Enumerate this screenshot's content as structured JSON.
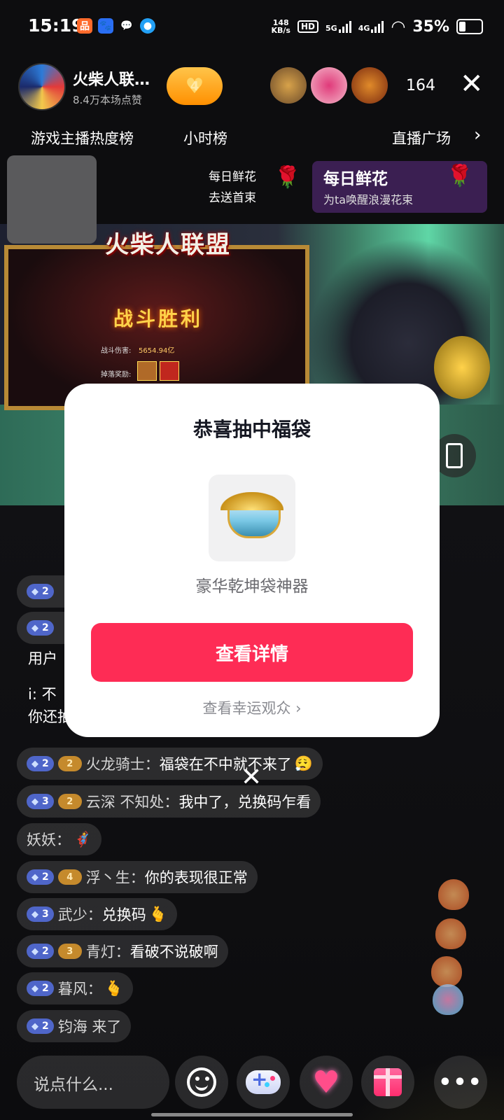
{
  "status_bar": {
    "time": "15:19",
    "net_speed_value": "148",
    "net_speed_unit": "KB/s",
    "hd_label": "HD",
    "signal1_label": "5G",
    "signal2_label": "4G",
    "battery_text": "35%",
    "battery_level": 0.35,
    "app_icons": [
      "app-icon",
      "baidu-icon",
      "wechat-icon",
      "qq-icon"
    ]
  },
  "header": {
    "streamer_name": "火柴人联…",
    "streamer_likes": "8.4万本场点赞",
    "fan_badge_level": "4",
    "viewer_count": "164"
  },
  "tabs": {
    "hot_rank": "游戏主播热度榜",
    "hour_rank": "小时榜",
    "plaza": "直播广场",
    "plaza_arrow": "›"
  },
  "flower_promo": {
    "line1": "每日鲜花",
    "line2": "去送首束",
    "card_title": "每日鲜花",
    "card_subtitle": "为ta唤醒浪漫花束"
  },
  "game": {
    "logo": "火柴人联盟",
    "victory_text": "战斗胜利",
    "damage_label": "战斗伤害:",
    "damage_value": "5654.94亿",
    "reward_label": "掉落奖励:"
  },
  "chat": {
    "partial_line1": "用户",
    "partial_line2_prefix": "i: 不",
    "partial_line3": "你还抽",
    "messages": [
      {
        "level": "2",
        "fan": "2",
        "user": "火龙骑士：",
        "text": "福袋在不中就不来了",
        "emoji": "😮‍💨"
      },
      {
        "level": "3",
        "fan": "2",
        "user": "云深 不知处：",
        "text": "我中了，兑换码乍看",
        "emoji": ""
      },
      {
        "level": "",
        "fan": "",
        "user": "妖妖：",
        "text": "",
        "emoji": "🦸"
      },
      {
        "level": "2",
        "fan": "4",
        "user": "浮丶生：",
        "text": "你的表现很正常",
        "emoji": ""
      },
      {
        "level": "3",
        "fan": "",
        "user": "武少：",
        "text": "兑换码",
        "emoji": "🫰"
      },
      {
        "level": "2",
        "fan": "3",
        "user": "青灯：",
        "text": "看破不说破啊",
        "emoji": ""
      },
      {
        "level": "2",
        "fan": "",
        "user": "暮风：",
        "text": "",
        "emoji": "🫰"
      },
      {
        "level": "2",
        "fan": "",
        "user": "钧海 来了",
        "text": "",
        "emoji": ""
      }
    ],
    "partial_badges": [
      "2",
      "2"
    ]
  },
  "modal": {
    "title": "恭喜抽中福袋",
    "prize_name": "豪华乾坤袋神器",
    "detail_button": "查看详情",
    "lucky_link": "查看幸运观众 ›",
    "close": "✕"
  },
  "bottom_bar": {
    "input_placeholder": "说点什么...",
    "more": "•••"
  },
  "colors": {
    "accent": "#fe2c55",
    "fan_badge": "#ff9f1a",
    "level_badge": "#4f66c9",
    "flower_card": "#3b1f52"
  }
}
